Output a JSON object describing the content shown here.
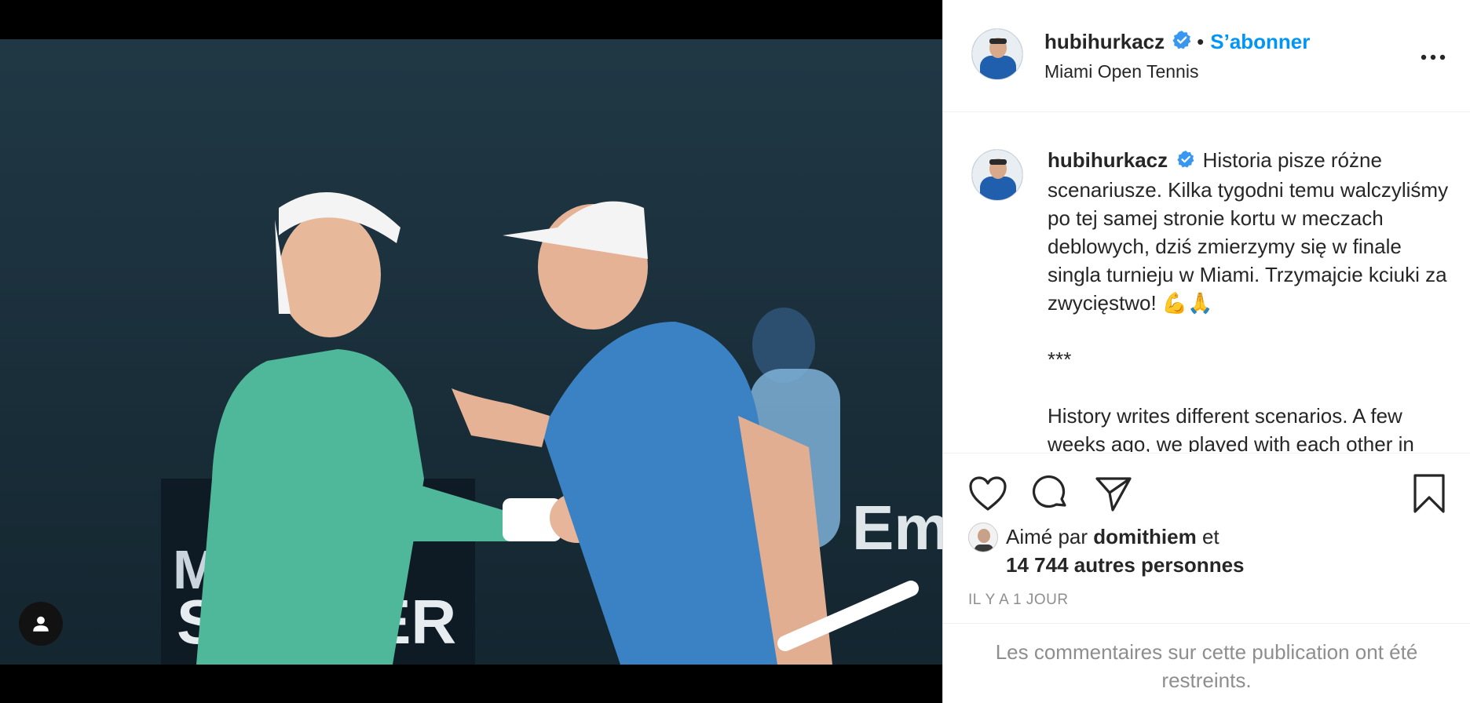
{
  "post": {
    "author": {
      "username": "hubihurkacz",
      "verified": true,
      "location": "Miami Open Tennis",
      "follow_label": "S’abonner",
      "separator": "•"
    },
    "caption": {
      "username": "hubihurkacz",
      "paragraph_pl": "Historia pisze różne scenariusze. Kilka tygodni temu walczyliśmy po tej samej stronie kortu w meczach deblowych, dziś zmierzymy się w finale singla turnieju w Miami. Trzymajcie kciuki za zwycięstwo! 💪🙏",
      "separator": "***",
      "paragraph_en": "History writes different scenarios. A few weeks ago, we played with each other in doubles, today we face each other in the singles final in Miami."
    },
    "likes": {
      "prefix": "Aimé par",
      "liker": "domithiem",
      "conjunction": "et",
      "others": "14 744 autres personnes"
    },
    "timestamp": "IL Y A 1 JOUR",
    "comments_restricted": "Les commentaires sur cette publication ont été restreints."
  },
  "photo": {
    "background_words": [
      "MI",
      "S",
      "ER",
      "Em"
    ]
  },
  "icons": {
    "like": "heart-icon",
    "comment": "comment-icon",
    "share": "paper-plane-icon",
    "save": "bookmark-icon",
    "more": "more-options-icon",
    "tag": "user-tag-icon",
    "verified": "verified-badge-icon"
  },
  "colors": {
    "link_blue": "#0095f6",
    "verified_blue": "#3897f0",
    "muted_text": "#8e8e8e",
    "text": "#262626",
    "shirt_green": "#4fb89a",
    "shirt_blue": "#3b82c4"
  }
}
